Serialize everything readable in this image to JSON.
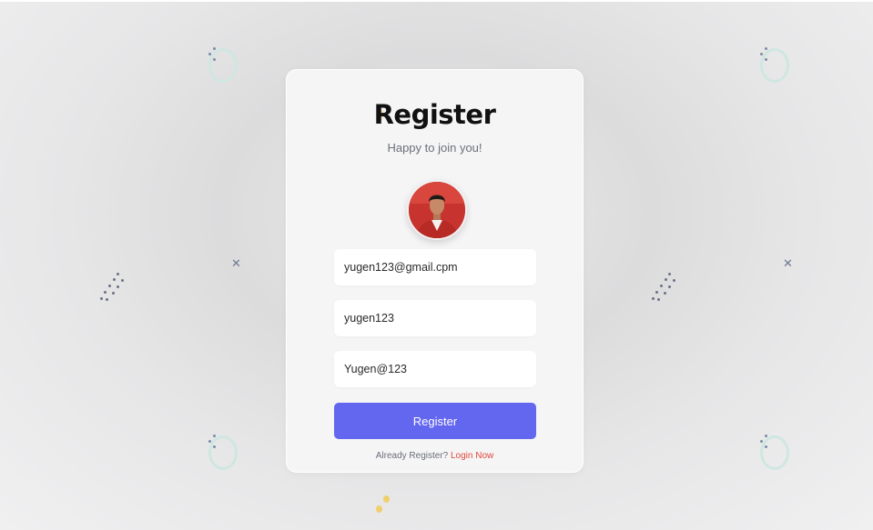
{
  "form": {
    "title": "Register",
    "subtitle": "Happy to join you!",
    "email_value": "yugen123@gmail.cpm",
    "username_value": "yugen123",
    "password_value": "Yugen@123",
    "submit_label": "Register",
    "footer_text": "Already Register?",
    "login_link": "Login Now"
  },
  "colors": {
    "accent": "#6366ee",
    "link": "#e2473c",
    "ring": "#cfe6e1"
  },
  "icons": [
    "profile-avatar",
    "x-mark-icon",
    "ring-decoration",
    "dot-line-decoration"
  ]
}
